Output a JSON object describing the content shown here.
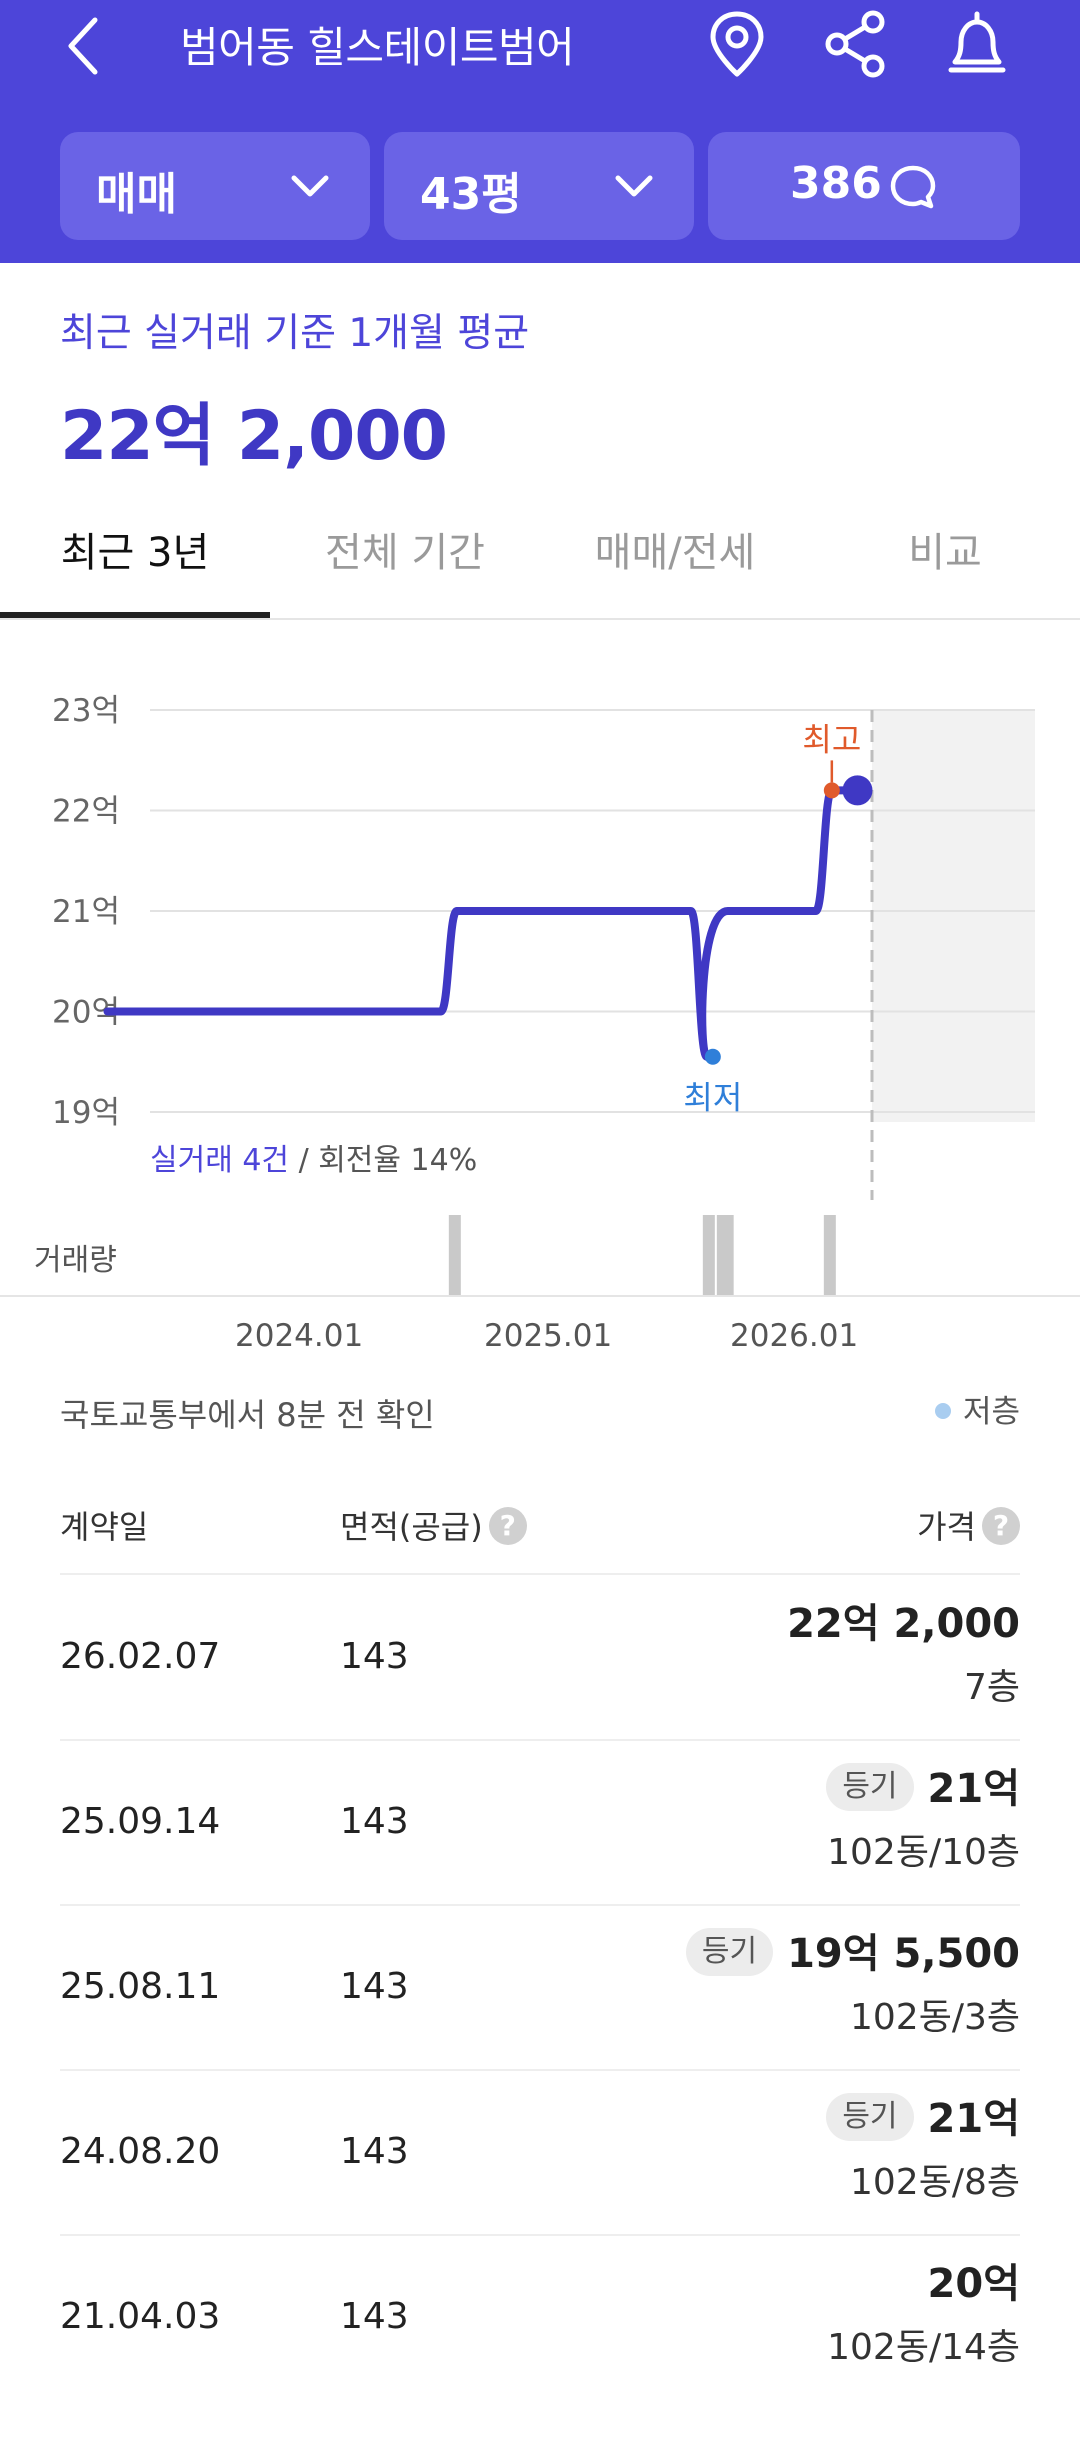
{
  "header": {
    "title": "범어동 힐스테이트범어",
    "icons": [
      "back-icon",
      "location-pin-icon",
      "share-icon",
      "bell-icon"
    ],
    "chips": {
      "trade_type": "매매",
      "area": "43평",
      "comments": "386"
    },
    "colors": {
      "bg": "#4d45d9",
      "chip": "#6a63e6"
    }
  },
  "summary": {
    "label": "최근 실거래 기준 1개월 평균",
    "value": "22억 2,000"
  },
  "tabs": [
    "최근 3년",
    "전체 기간",
    "매매/전세",
    "비교"
  ],
  "active_tab": "최근 3년",
  "chart_data": {
    "type": "line",
    "y_ticks": [
      "23억",
      "22억",
      "21억",
      "20억",
      "19억"
    ],
    "ylim": [
      19,
      23
    ],
    "y_unit": "억",
    "x_ticks": [
      "2024.01",
      "2025.01",
      "2026.01"
    ],
    "series": [
      {
        "values": [
          {
            "date": "2023.04",
            "y": 20.0
          },
          {
            "date": "2024.08",
            "y": 20.0
          },
          {
            "date": "2024.08",
            "y": 21.0
          },
          {
            "date": "2025.08",
            "y": 21.0
          },
          {
            "date": "2025.08",
            "y": 19.55
          },
          {
            "date": "2025.09",
            "y": 21.0
          },
          {
            "date": "2026.02",
            "y": 21.0
          },
          {
            "date": "2026.02",
            "y": 22.2
          },
          {
            "date": "2026.04",
            "y": 22.2
          }
        ]
      }
    ],
    "annotations": [
      {
        "label": "최고",
        "date": "2026.02",
        "y": 22.2,
        "color": "#e05a2b"
      },
      {
        "label": "최저",
        "date": "2025.08",
        "y": 19.55,
        "color": "#2f7fd9"
      }
    ],
    "volume_label": "거래량",
    "volume_dates": [
      "2024.08",
      "2025.08",
      "2025.08",
      "2025.09",
      "2026.02"
    ],
    "footer": {
      "deals": "실거래 4건",
      "turnover": " / 회전율 14%"
    },
    "grid": true,
    "line_color": "#3f38c4"
  },
  "info": {
    "source": "국토교통부에서 8분 전 확인",
    "legend": "저층"
  },
  "table": {
    "headers": {
      "date": "계약일",
      "area": "면적(공급)",
      "price": "가격"
    },
    "rows": [
      {
        "date": "26.02.07",
        "area": "143",
        "badge": "",
        "price": "22억 2,000",
        "floor": "7층"
      },
      {
        "date": "25.09.14",
        "area": "143",
        "badge": "등기",
        "price": "21억",
        "floor": "102동/10층"
      },
      {
        "date": "25.08.11",
        "area": "143",
        "badge": "등기",
        "price": "19억 5,500",
        "floor": "102동/3층"
      },
      {
        "date": "24.08.20",
        "area": "143",
        "badge": "등기",
        "price": "21억",
        "floor": "102동/8층"
      },
      {
        "date": "21.04.03",
        "area": "143",
        "badge": "",
        "price": "20억",
        "floor": "102동/14층"
      }
    ]
  }
}
